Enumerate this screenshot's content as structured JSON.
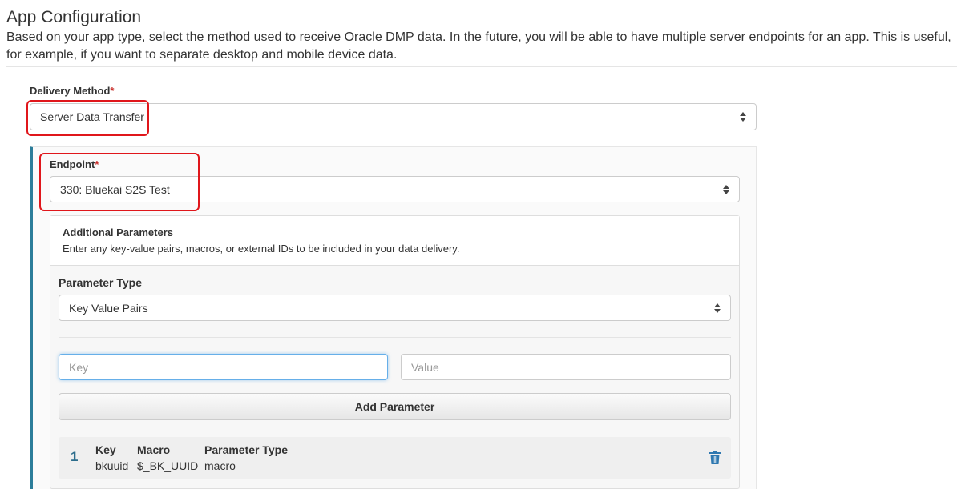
{
  "header": {
    "title": "App Configuration",
    "description": "Based on your app type, select the method used to receive Oracle DMP data. In the future, you will be able to have multiple server endpoints for an app. This is useful, for example, if you want to separate desktop and mobile device data."
  },
  "delivery": {
    "label": "Delivery Method",
    "required_mark": "*",
    "selected": "Server Data Transfer"
  },
  "endpoint": {
    "label": "Endpoint",
    "required_mark": "*",
    "selected": "330: Bluekai S2S Test"
  },
  "params": {
    "title": "Additional Parameters",
    "description": "Enter any key-value pairs, macros, or external IDs to be included in your data delivery.",
    "type_label": "Parameter Type",
    "type_selected": "Key Value Pairs",
    "key_placeholder": "Key",
    "value_placeholder": "Value",
    "add_label": "Add Parameter",
    "rows": [
      {
        "index": "1",
        "key_header": "Key",
        "key_value": "bkuuid",
        "macro_header": "Macro",
        "macro_value": "$_BK_UUID",
        "type_header": "Parameter Type",
        "type_value": "macro"
      }
    ]
  },
  "colors": {
    "accent": "#2c7d9a",
    "highlight": "#e0161b",
    "trash": "#2f78b0"
  },
  "icons": {
    "select_arrows": "up-down-arrows-icon",
    "delete": "trash-icon"
  }
}
